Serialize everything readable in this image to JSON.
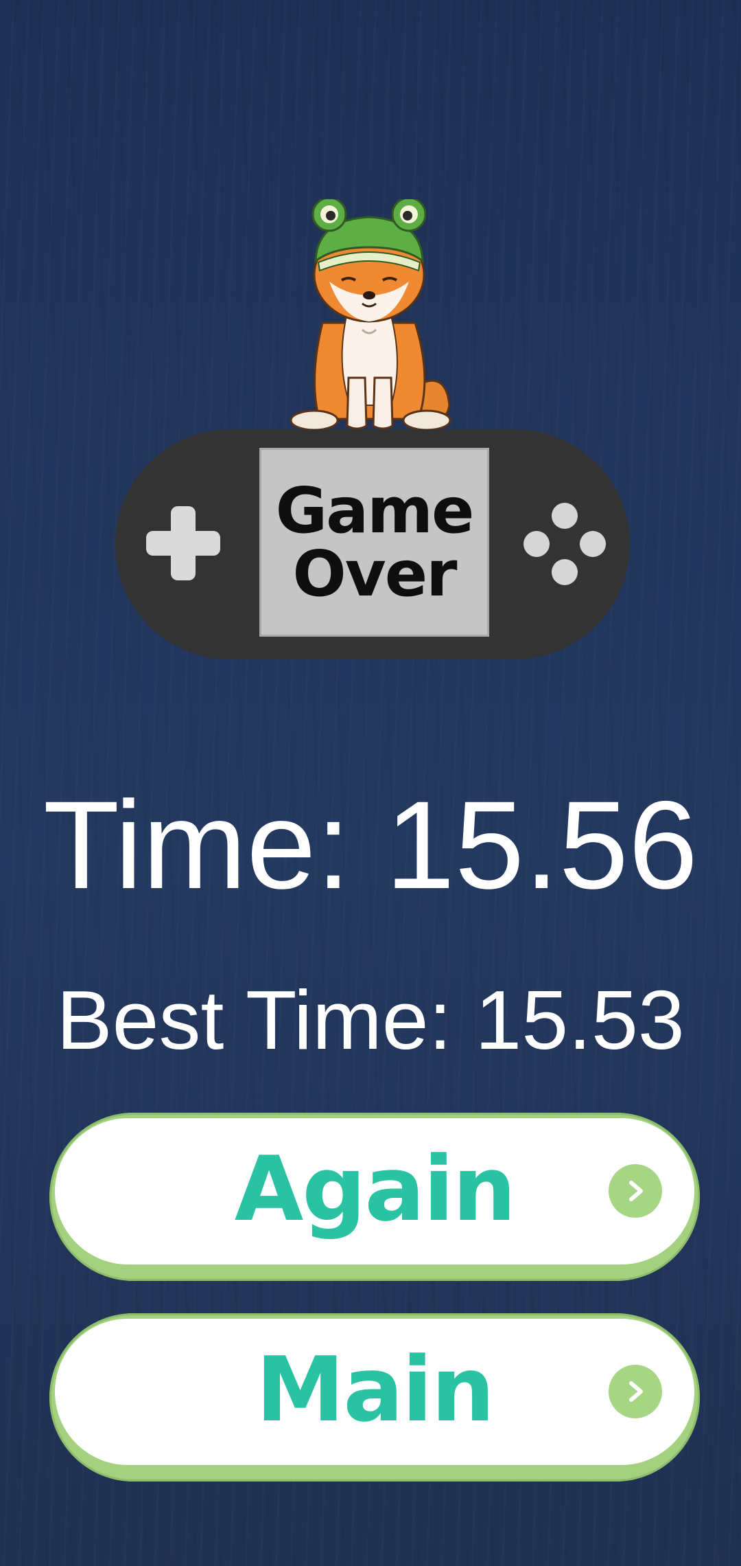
{
  "game_over": {
    "screen_line1": "Game",
    "screen_line2": "Over"
  },
  "stats": {
    "time_text": "Time: 15.56",
    "best_time_text": "Best Time: 15.53"
  },
  "buttons": {
    "again_label": "Again",
    "main_label": "Main"
  },
  "icons": {
    "mascot": "shiba-dog-frog-hat-icon",
    "dpad": "dpad-icon",
    "action_buttons": "action-buttons-icon",
    "arrow": "chevron-right-icon"
  },
  "colors": {
    "background": "#22365d",
    "console": "#333333",
    "screen": "#c5c5c5",
    "button_text": "#29c3a3",
    "button_border": "#a3d17f",
    "arrow_circle": "#a6d583"
  }
}
